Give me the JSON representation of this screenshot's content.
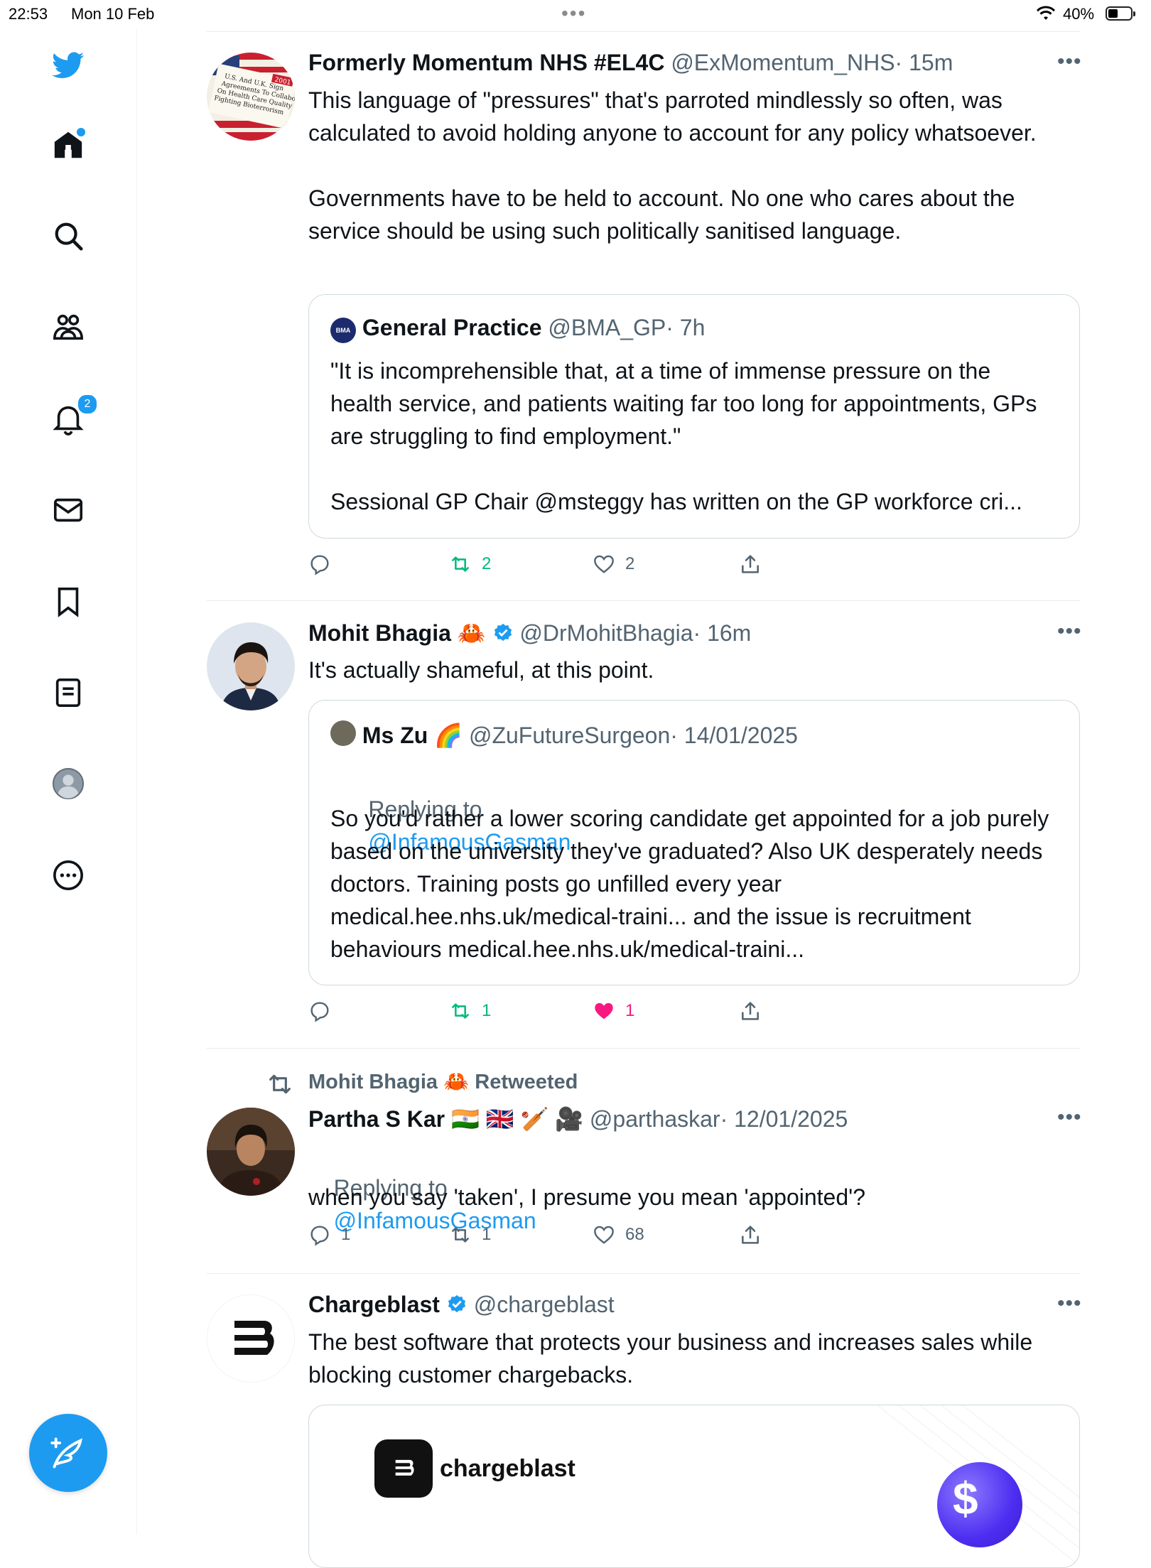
{
  "status_bar": {
    "time": "22:53",
    "date": "Mon 10 Feb",
    "dots": "•••",
    "battery": "40%"
  },
  "sidebar": {
    "notifications_badge": "2",
    "colors": {
      "accent": "#1d9bf0"
    }
  },
  "tweets": [
    {
      "name": "Formerly Momentum NHS #EL4C",
      "handle": "@ExMomentum_NHS",
      "time": "· 15m",
      "text": "This language of \"pressures\" that's parroted mindlessly so often, was calculated to avoid holding anyone to account for any policy whatsoever.\n\nGovernments have to be held to account. No one who cares about the service should be using such politically sanitised language.",
      "quote": {
        "name": "General Practice",
        "handle": "@BMA_GP",
        "time": "· 7h",
        "text": "\"It is incomprehensible that, at a time of immense pressure on the health service, and patients waiting far too long for appointments, GPs are struggling to find employment.\"\n\nSessional GP Chair @msteggy has written on the GP workforce cri..."
      },
      "avatar_caption": "2001 U.S. And U.K. Sign Agreements To Collaborate On Health Care Quality And Fighting Bioterrorism",
      "retweets": "2",
      "likes": "2"
    },
    {
      "name": "Mohit Bhagia",
      "emoji": "🦀",
      "handle": "@DrMohitBhagia",
      "time": "· 16m",
      "text": "It's actually shameful, at this point.",
      "quote": {
        "name": "Ms Zu",
        "emoji": "🌈",
        "handle": "@ZuFutureSurgeon",
        "time": "· 14/01/2025",
        "replying_prefix": "Replying to",
        "replying_to": "@InfamousGasman",
        "text": "So you'd rather a lower scoring candidate get appointed for a job purely based on the university they've graduated? Also UK desperately needs doctors. Training posts go unfilled every year medical.hee.nhs.uk/medical-traini... and the issue is recruitment behaviours medical.hee.nhs.uk/medical-traini..."
      },
      "retweets": "1",
      "likes": "1"
    },
    {
      "retweeted_by": "Mohit Bhagia",
      "retweeted_emoji": "🦀",
      "retweeted_label": "Retweeted",
      "name": "Partha S Kar",
      "emoji": "🇮🇳 🇬🇧 🏏 🎥",
      "handle": "@parthaskar",
      "time": "· 12/01/2025",
      "replying_prefix": "Replying to",
      "replying_to": "@InfamousGasman",
      "text": "when you say 'taken', I presume you mean 'appointed'?",
      "replies": "1",
      "retweets": "1",
      "likes": "68"
    },
    {
      "name": "Chargeblast",
      "handle": "@chargeblast",
      "text": "The best software that protects your business and increases sales while blocking customer chargebacks.",
      "card_brand": "chargeblast"
    }
  ]
}
